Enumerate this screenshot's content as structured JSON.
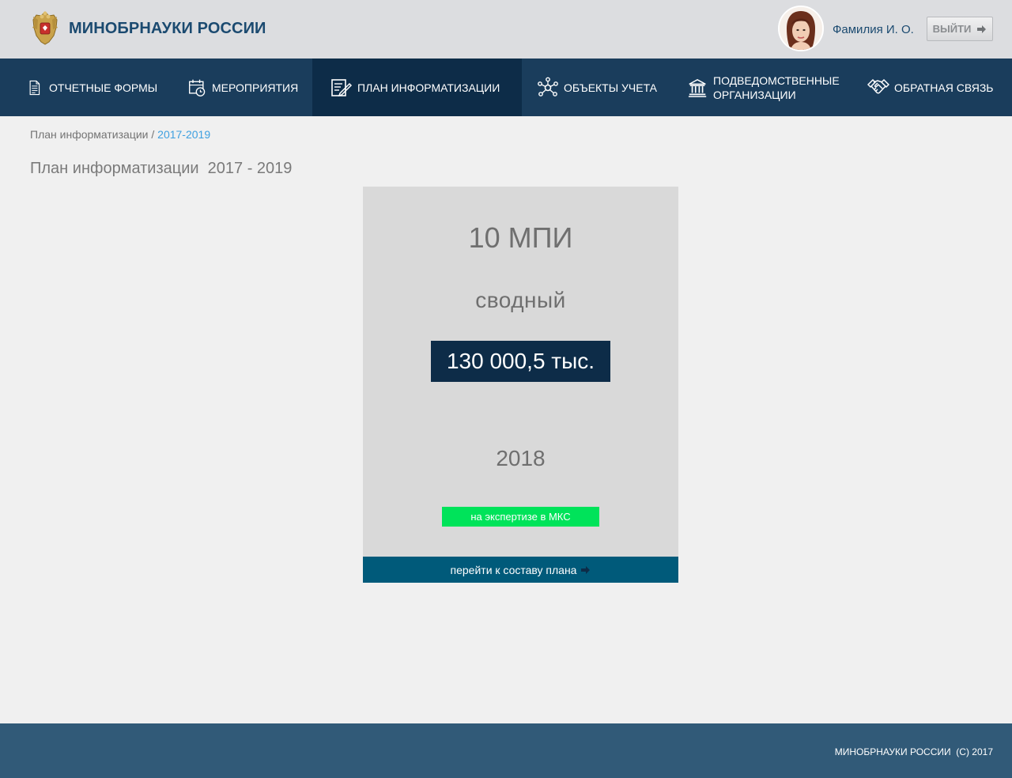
{
  "header": {
    "brand": "МИНОБРНАУКИ РОССИИ",
    "user_name": "Фамилия И. О.",
    "logout_label": "ВЫЙТИ"
  },
  "nav": {
    "items": [
      {
        "label": "ОТЧЕТНЫЕ ФОРМЫ",
        "icon": "document-icon",
        "active": false
      },
      {
        "label": "МЕРОПРИЯТИЯ",
        "icon": "calendar-clock-icon",
        "active": false
      },
      {
        "label": "ПЛАН ИНФОРМАТИЗАЦИИ",
        "icon": "plan-edit-icon",
        "active": true
      },
      {
        "label": "ОБЪЕКТЫ УЧЕТА",
        "icon": "network-icon",
        "active": false
      },
      {
        "label_line1": "ПОДВЕДОМСТВЕННЫЕ",
        "label_line2": "ОРГАНИЗАЦИИ",
        "icon": "institution-icon",
        "active": false
      },
      {
        "label": "ОБРАТНАЯ СВЯЗЬ",
        "icon": "handshake-icon",
        "active": false
      }
    ]
  },
  "breadcrumb": {
    "parent": "План информатизации",
    "separator": " / ",
    "current": "2017-2019"
  },
  "page_title": "План информатизации  2017 - 2019",
  "card": {
    "name": "10 МПИ",
    "type": "сводный",
    "amount": "130 000,5 тыс.",
    "year": "2018",
    "status": "на экспертизе в МКС",
    "footer_link": "перейти к составу плана"
  },
  "footer": {
    "copyright": "МИНОБРНАУКИ РОССИИ  (С) 2017"
  },
  "colors": {
    "header_bg": "#dcdde0",
    "nav_bg": "#1a3d5c",
    "nav_active_bg": "#0d2c48",
    "brand": "#1b4a70",
    "card_bg": "#d9d9d9",
    "amount_bg": "#0d2c48",
    "status_bg": "#00e35a",
    "card_footer_bg": "#005a7a",
    "footer_bg": "#315a78",
    "breadcrumb_current": "#3ea0e0"
  }
}
